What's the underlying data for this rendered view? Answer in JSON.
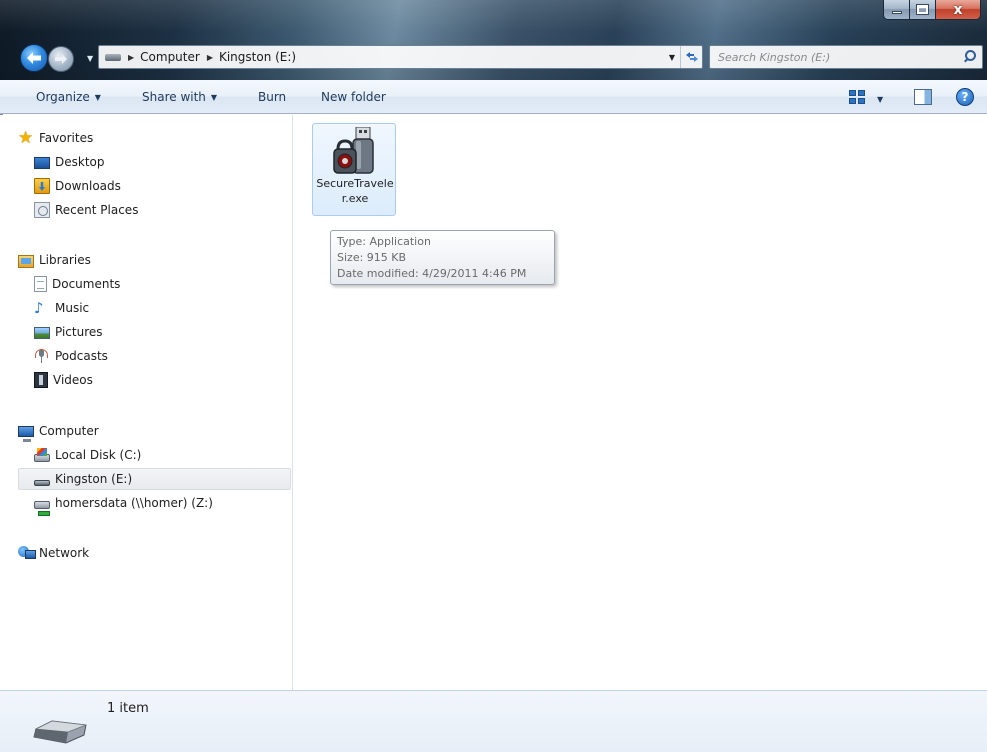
{
  "window": {
    "caption_buttons": {
      "minimize": "–",
      "maximize": "□",
      "close": "x"
    }
  },
  "address_bar": {
    "breadcrumbs": [
      "Computer",
      "Kingston (E:)"
    ],
    "search_placeholder": "Search Kingston (E:)"
  },
  "command_bar": {
    "organize": "Organize",
    "share_with": "Share with",
    "burn": "Burn",
    "new_folder": "New folder",
    "help": "?"
  },
  "nav_pane": {
    "favorites": {
      "label": "Favorites",
      "items": [
        "Desktop",
        "Downloads",
        "Recent Places"
      ]
    },
    "libraries": {
      "label": "Libraries",
      "items": [
        "Documents",
        "Music",
        "Pictures",
        "Podcasts",
        "Videos"
      ]
    },
    "computer": {
      "label": "Computer",
      "items": [
        "Local Disk (C:)",
        "Kingston (E:)",
        "homersdata (\\\\homer) (Z:)"
      ],
      "selected": "Kingston (E:)"
    },
    "network": {
      "label": "Network"
    }
  },
  "content": {
    "files": [
      {
        "name": "SecureTraveler.exe",
        "icon": "usb-security-app-icon"
      }
    ],
    "tooltip": {
      "type": "Type: Application",
      "size": "Size: 915 KB",
      "date": "Date modified: 4/29/2011 4:46 PM"
    }
  },
  "details_pane": {
    "item_count": "1 item"
  },
  "colors": {
    "accent": "#2f8ae0",
    "selection_bg": "#dcecfc",
    "command_bar_text": "#1e3a5c"
  }
}
